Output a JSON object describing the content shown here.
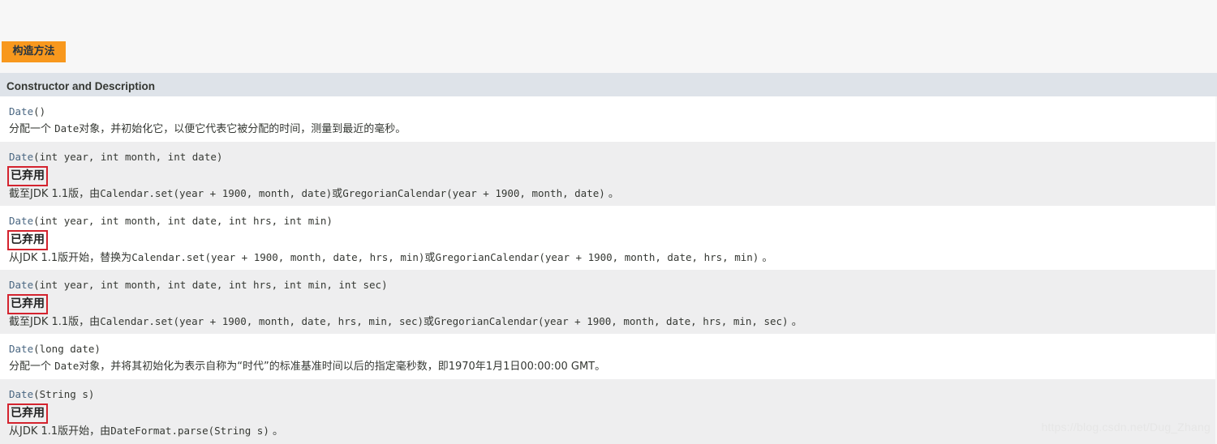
{
  "tab": {
    "label": "构造方法"
  },
  "table": {
    "header": "Constructor and Description",
    "rows": [
      {
        "name": "Date",
        "params": "()",
        "deprecated": "",
        "desc_pre": "分配一个 ",
        "desc_code1": "Date",
        "desc_mid": "对象，并初始化它，以便它代表它被分配的时间，测量到最近的毫秒。",
        "desc_code2": "",
        "desc_mid2": "",
        "desc_code3": "",
        "desc_end": ""
      },
      {
        "name": "Date",
        "params": "(int year, int month, int date)",
        "deprecated": "已弃用",
        "desc_pre": "截至JDK 1.1版，由",
        "desc_code1": "Calendar.set(year + 1900, month, date)",
        "desc_mid": "或",
        "desc_code2": "GregorianCalendar(year + 1900, month, date)",
        "desc_mid2": "",
        "desc_code3": "",
        "desc_end": " 。"
      },
      {
        "name": "Date",
        "params": "(int year, int month, int date, int hrs, int min)",
        "deprecated": "已弃用",
        "desc_pre": "从JDK 1.1版开始，替换为",
        "desc_code1": "Calendar.set(year + 1900, month, date, hrs, min)",
        "desc_mid": "或",
        "desc_code2": "GregorianCalendar(year + 1900, month, date, hrs, min)",
        "desc_mid2": "",
        "desc_code3": "",
        "desc_end": " 。"
      },
      {
        "name": "Date",
        "params": "(int year, int month, int date, int hrs, int min, int sec)",
        "deprecated": "已弃用",
        "desc_pre": "截至JDK 1.1版，由",
        "desc_code1": "Calendar.set(year + 1900, month, date, hrs, min, sec)",
        "desc_mid": "或",
        "desc_code2": "GregorianCalendar(year + 1900, month, date, hrs, min, sec)",
        "desc_mid2": "",
        "desc_code3": "",
        "desc_end": " 。"
      },
      {
        "name": "Date",
        "params": "(long date)",
        "deprecated": "",
        "desc_pre": "分配一个 ",
        "desc_code1": "Date",
        "desc_mid": "对象，并将其初始化为表示自称为“时代”的标准基准时间以后的指定毫秒数，即1970年1月1日00:00:00 GMT。",
        "desc_code2": "",
        "desc_mid2": "",
        "desc_code3": "",
        "desc_end": ""
      },
      {
        "name": "Date",
        "params": "(String s)",
        "deprecated": "已弃用",
        "desc_pre": "从JDK 1.1版开始，由",
        "desc_code1": "DateFormat.parse(String s)",
        "desc_mid": "",
        "desc_code2": "",
        "desc_mid2": "",
        "desc_code3": "",
        "desc_end": " 。"
      }
    ]
  },
  "watermark": "https://blog.csdn.net/Dug_Zhang",
  "colors": {
    "tab_bg": "#f8981d",
    "header_bg": "#dee3e9",
    "row_grey": "#eeeeef",
    "link": "#4a6782",
    "deprecated_border": "#d4232e"
  }
}
